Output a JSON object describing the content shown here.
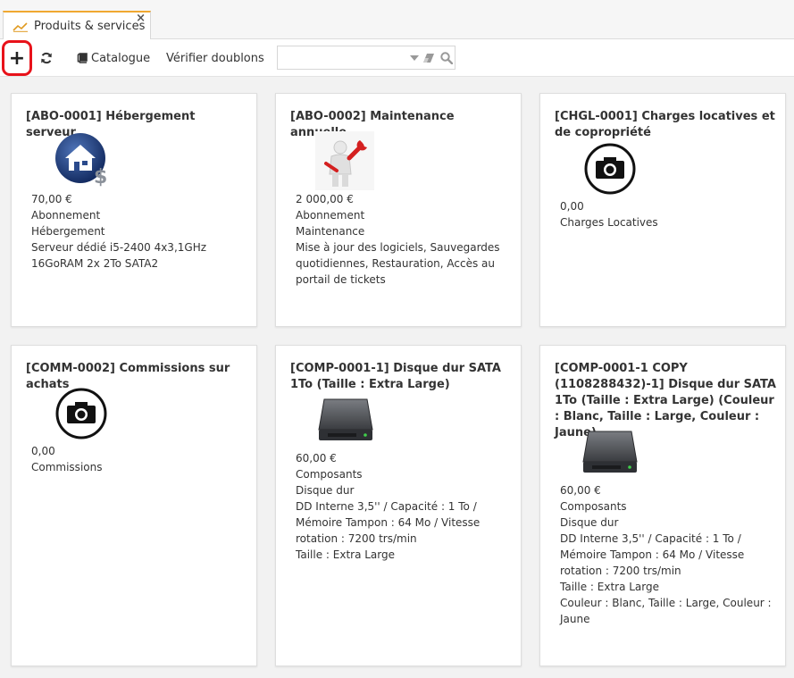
{
  "tab": {
    "label": "Produits & services",
    "close": "×"
  },
  "toolbar": {
    "add": "+",
    "catalogue": "Catalogue",
    "verify_duplicates": "Vérifier doublons",
    "search_value": "",
    "search_placeholder": ""
  },
  "colors": {
    "accent_tab": "#f0a830",
    "highlight_red": "#e8121a"
  },
  "products": [
    {
      "title": "[ABO-0001] Hébergement serveur",
      "image": "server-house-icon",
      "lines": [
        "70,00 €",
        "Abonnement",
        "Hébergement",
        "Serveur dédié i5-2400 4x3,1GHz 16GoRAM 2x 2To SATA2"
      ]
    },
    {
      "title": "[ABO-0002] Maintenance annuelle",
      "image": "maintenance-figure-icon",
      "lines": [
        "2 000,00 €",
        "Abonnement",
        "Maintenance",
        "Mise à jour des logiciels, Sauvegardes quotidiennes, Restauration, Accès au portail de tickets"
      ]
    },
    {
      "title": "[CHGL-0001] Charges locatives et de copropriété",
      "image": "camera-icon",
      "lines": [
        "0,00",
        "Charges Locatives"
      ]
    },
    {
      "title": "[COMM-0002] Commissions sur achats",
      "image": "camera-icon",
      "lines": [
        "0,00",
        "Commissions"
      ]
    },
    {
      "title": "[COMP-0001-1] Disque dur SATA 1To (Taille : Extra Large)",
      "image": "hard-drive-icon",
      "lines": [
        "60,00 €",
        "Composants",
        "Disque dur",
        "DD Interne 3,5'' / Capacité : 1 To / Mémoire Tampon : 64 Mo / Vitesse rotation : 7200 trs/min",
        "Taille : Extra Large"
      ]
    },
    {
      "title": "[COMP-0001-1 COPY (1108288432)-1] Disque dur SATA 1To (Taille : Extra Large) (Couleur : Blanc, Taille : Large, Couleur : Jaune)",
      "image": "hard-drive-icon",
      "lines": [
        "60,00 €",
        "Composants",
        "Disque dur",
        "DD Interne 3,5'' / Capacité : 1 To / Mémoire Tampon : 64 Mo / Vitesse rotation : 7200 trs/min",
        "Taille : Extra Large",
        "Couleur : Blanc, Taille : Large, Couleur : Jaune"
      ]
    }
  ]
}
